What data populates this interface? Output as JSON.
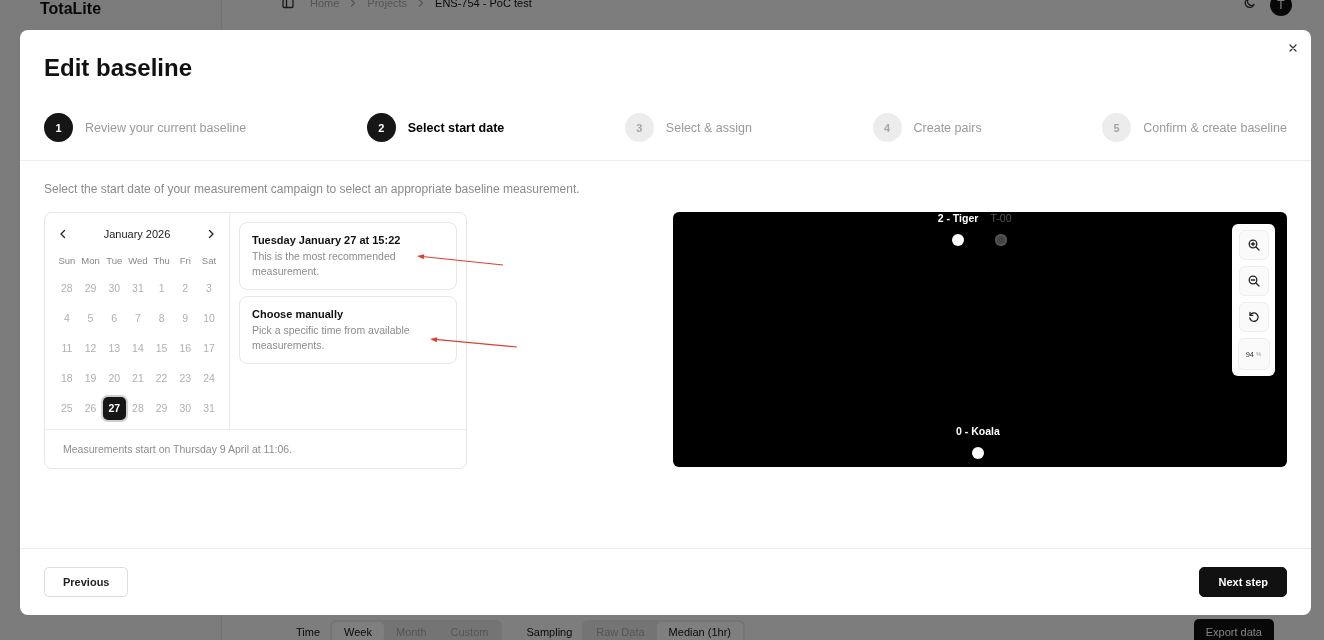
{
  "background": {
    "app_name": "TotaLite",
    "breadcrumb": [
      "Home",
      "Projects",
      "ENS-754 - PoC test"
    ],
    "avatar_initial": "T",
    "time_filter": {
      "label": "Time",
      "options": [
        {
          "label": "Week",
          "selected": true
        },
        {
          "label": "Month",
          "selected": false
        },
        {
          "label": "Custom",
          "selected": false
        }
      ]
    },
    "sampling_filter": {
      "label": "Sampling",
      "options": [
        {
          "label": "Raw Data",
          "selected": false
        },
        {
          "label": "Median (1hr)",
          "selected": true
        }
      ]
    },
    "export_button": "Export data"
  },
  "modal": {
    "title": "Edit baseline",
    "steps": [
      {
        "number": "1",
        "label": "Review your current baseline",
        "selected": false
      },
      {
        "number": "2",
        "label": "Select start date",
        "selected": true
      },
      {
        "number": "3",
        "label": "Select & assign",
        "selected": false
      },
      {
        "number": "4",
        "label": "Create pairs",
        "selected": false
      },
      {
        "number": "5",
        "label": "Confirm & create baseline",
        "selected": false
      }
    ],
    "description": "Select the start date of your measurement campaign to select an appropriate baseline measurement.",
    "calendar": {
      "month": "January 2026",
      "weekdays": [
        "Sun",
        "Mon",
        "Tue",
        "Wed",
        "Thu",
        "Fri",
        "Sat"
      ],
      "weeks": [
        [
          {
            "day": "28",
            "disabled": true,
            "selected": false
          },
          {
            "day": "29",
            "disabled": true,
            "selected": false
          },
          {
            "day": "30",
            "disabled": true,
            "selected": false
          },
          {
            "day": "31",
            "disabled": true,
            "selected": false
          },
          {
            "day": "1",
            "disabled": true,
            "selected": false
          },
          {
            "day": "2",
            "disabled": true,
            "selected": false
          },
          {
            "day": "3",
            "disabled": true,
            "selected": false
          }
        ],
        [
          {
            "day": "4",
            "disabled": true,
            "selected": false
          },
          {
            "day": "5",
            "disabled": true,
            "selected": false
          },
          {
            "day": "6",
            "disabled": true,
            "selected": false
          },
          {
            "day": "7",
            "disabled": true,
            "selected": false
          },
          {
            "day": "8",
            "disabled": true,
            "selected": false
          },
          {
            "day": "9",
            "disabled": true,
            "selected": false
          },
          {
            "day": "10",
            "disabled": true,
            "selected": false
          }
        ],
        [
          {
            "day": "11",
            "disabled": true,
            "selected": false
          },
          {
            "day": "12",
            "disabled": true,
            "selected": false
          },
          {
            "day": "13",
            "disabled": true,
            "selected": false
          },
          {
            "day": "14",
            "disabled": true,
            "selected": false
          },
          {
            "day": "15",
            "disabled": true,
            "selected": false
          },
          {
            "day": "16",
            "disabled": true,
            "selected": false
          },
          {
            "day": "17",
            "disabled": true,
            "selected": false
          }
        ],
        [
          {
            "day": "18",
            "disabled": true,
            "selected": false
          },
          {
            "day": "19",
            "disabled": true,
            "selected": false
          },
          {
            "day": "20",
            "disabled": true,
            "selected": false
          },
          {
            "day": "21",
            "disabled": true,
            "selected": false
          },
          {
            "day": "22",
            "disabled": true,
            "selected": false
          },
          {
            "day": "23",
            "disabled": true,
            "selected": false
          },
          {
            "day": "24",
            "disabled": true,
            "selected": false
          }
        ],
        [
          {
            "day": "25",
            "disabled": true,
            "selected": false
          },
          {
            "day": "26",
            "disabled": true,
            "selected": false
          },
          {
            "day": "27",
            "disabled": false,
            "selected": true
          },
          {
            "day": "28",
            "disabled": true,
            "selected": false
          },
          {
            "day": "29",
            "disabled": true,
            "selected": false
          },
          {
            "day": "30",
            "disabled": true,
            "selected": false
          },
          {
            "day": "31",
            "disabled": true,
            "selected": false
          }
        ]
      ],
      "footer": "Measurements start on Thursday 9 April at 11:06."
    },
    "options": [
      {
        "title": "Tuesday January 27 at 15:22",
        "description": "This is the most recommended measurement."
      },
      {
        "title": "Choose manually",
        "description": "Pick a specific time from available measurements."
      }
    ],
    "canvas": {
      "nodes": [
        {
          "label": "2 - Tiger",
          "kind": "primary"
        },
        {
          "label": "T-00",
          "kind": "secondary"
        },
        {
          "label": "0 - Koala",
          "kind": "primary"
        }
      ],
      "zoom": {
        "value": "94",
        "unit": "%"
      }
    },
    "buttons": {
      "previous": "Previous",
      "next": "Next step"
    }
  }
}
